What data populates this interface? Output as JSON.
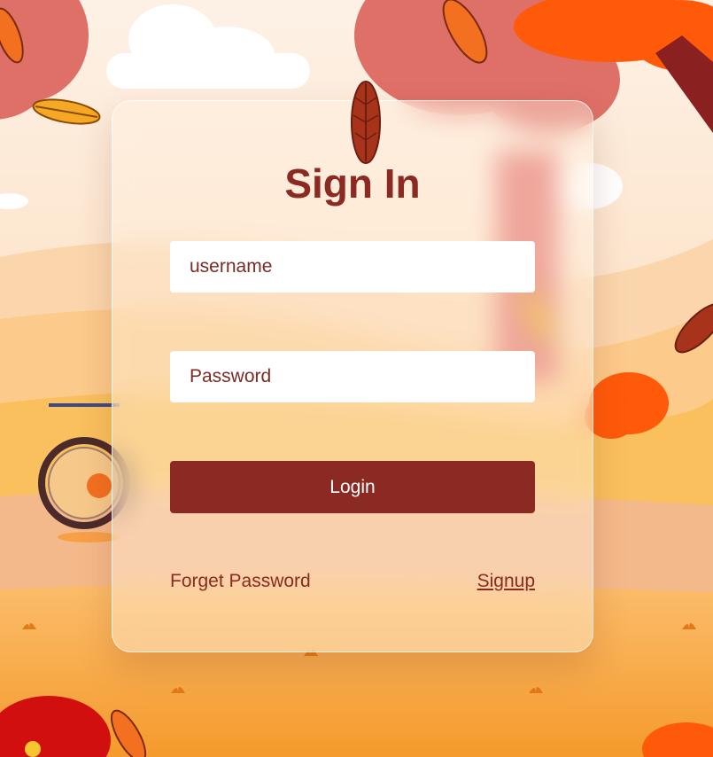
{
  "form": {
    "title": "Sign In",
    "username_placeholder": "username",
    "password_placeholder": "Password",
    "login_label": "Login",
    "forget_password_label": "Forget Password",
    "signup_label": "Signup"
  },
  "colors": {
    "accent": "#8b2a23",
    "background_sky": "#fde9d6",
    "ground_orange": "#f6a646"
  }
}
